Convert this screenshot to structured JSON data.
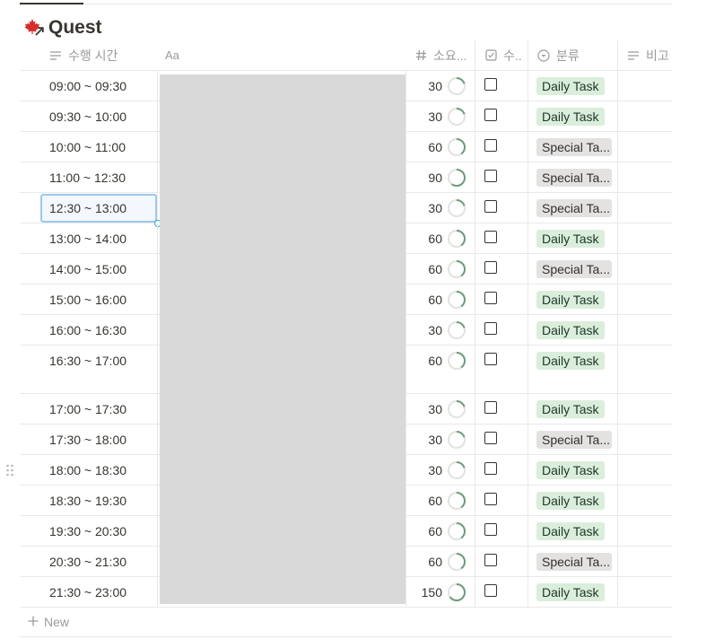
{
  "page": {
    "title": "Quest",
    "title_icon": "maple-leaf-arrow-icon",
    "new_label": "New"
  },
  "columns": {
    "time": "수행 시간",
    "name": "Aa",
    "duration": "소요...",
    "done": "수..",
    "category": "분류",
    "note": "비고"
  },
  "colors": {
    "daily_bg": "#dbeddb",
    "special_bg": "#e3e2e0",
    "ring_green": "#6c9b7d",
    "ring_track": "#e3e2e0",
    "selection": "#9cc9ef"
  },
  "rows": [
    {
      "time": "09:00 ~ 09:30",
      "minutes": "30",
      "progress": 0.2,
      "checked": false,
      "category": "Daily Task",
      "kind": "daily"
    },
    {
      "time": "09:30 ~ 10:00",
      "minutes": "30",
      "progress": 0.2,
      "checked": false,
      "category": "Daily Task",
      "kind": "daily"
    },
    {
      "time": "10:00 ~ 11:00",
      "minutes": "60",
      "progress": 0.4,
      "checked": false,
      "category": "Special Ta...",
      "kind": "special"
    },
    {
      "time": "11:00 ~ 12:30",
      "minutes": "90",
      "progress": 0.6,
      "checked": false,
      "category": "Special Ta...",
      "kind": "special"
    },
    {
      "time": "12:30 ~ 13:00",
      "minutes": "30",
      "progress": 0.2,
      "checked": false,
      "category": "Special Ta...",
      "kind": "special",
      "selected": true
    },
    {
      "time": "13:00 ~ 14:00",
      "minutes": "60",
      "progress": 0.4,
      "checked": false,
      "category": "Daily Task",
      "kind": "daily"
    },
    {
      "time": "14:00 ~ 15:00",
      "minutes": "60",
      "progress": 0.4,
      "checked": false,
      "category": "Special Ta...",
      "kind": "special"
    },
    {
      "time": "15:00 ~ 16:00",
      "minutes": "60",
      "progress": 0.4,
      "checked": false,
      "category": "Daily Task",
      "kind": "daily"
    },
    {
      "time": "16:00 ~ 16:30",
      "minutes": "30",
      "progress": 0.2,
      "checked": false,
      "category": "Daily Task",
      "kind": "daily"
    },
    {
      "time": "16:30 ~ 17:00",
      "minutes": "60",
      "progress": 0.4,
      "checked": false,
      "category": "Daily Task",
      "kind": "daily",
      "tall": true
    },
    {
      "time": "17:00 ~ 17:30",
      "minutes": "30",
      "progress": 0.2,
      "checked": false,
      "category": "Daily Task",
      "kind": "daily"
    },
    {
      "time": "17:30 ~ 18:00",
      "minutes": "30",
      "progress": 0.2,
      "checked": false,
      "category": "Special Ta...",
      "kind": "special"
    },
    {
      "time": "18:00 ~ 18:30",
      "minutes": "30",
      "progress": 0.2,
      "checked": false,
      "category": "Daily Task",
      "kind": "daily"
    },
    {
      "time": "18:30 ~ 19:30",
      "minutes": "60",
      "progress": 0.4,
      "checked": false,
      "category": "Daily Task",
      "kind": "daily"
    },
    {
      "time": "19:30 ~ 20:30",
      "minutes": "60",
      "progress": 0.4,
      "checked": false,
      "category": "Daily Task",
      "kind": "daily"
    },
    {
      "time": "20:30 ~ 21:30",
      "minutes": "60",
      "progress": 0.4,
      "checked": false,
      "category": "Special Ta...",
      "kind": "special"
    },
    {
      "time": "21:30 ~ 23:00",
      "minutes": "150",
      "progress": 0.65,
      "checked": false,
      "category": "Daily Task",
      "kind": "daily"
    }
  ]
}
